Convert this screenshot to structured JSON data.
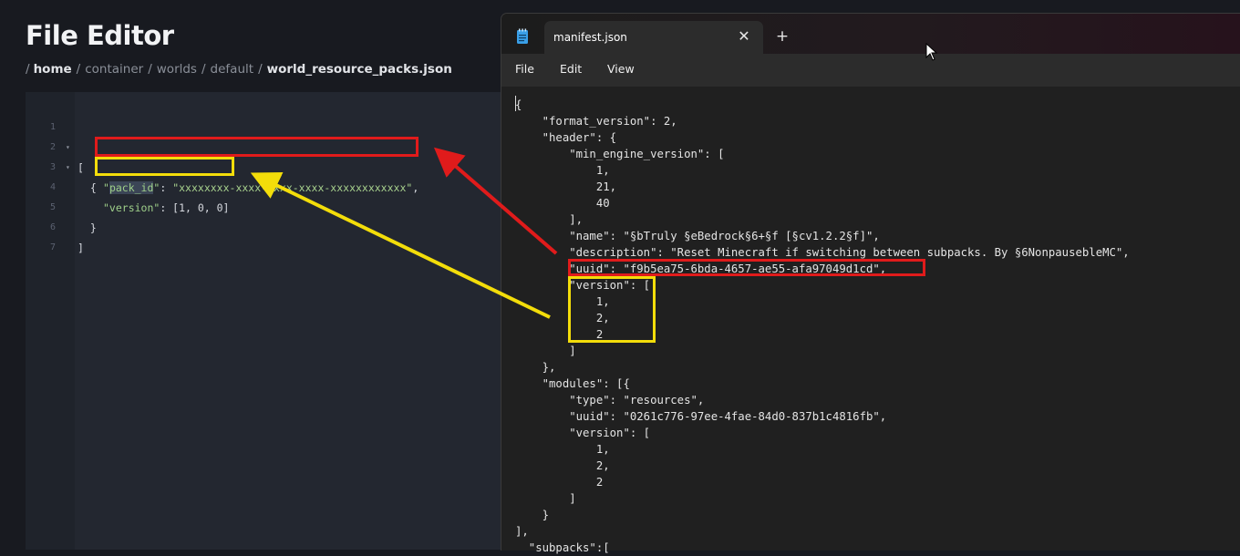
{
  "page": {
    "title": "File Editor",
    "breadcrumb": {
      "separator": "/",
      "items": [
        "home",
        "container",
        "worlds",
        "default",
        "world_resource_packs.json"
      ]
    }
  },
  "editor": {
    "lines": [
      {
        "num": "1",
        "fold": "▾",
        "text": "["
      },
      {
        "num": "2",
        "fold": "▾",
        "text": "  {"
      },
      {
        "num": "3",
        "fold": "",
        "key_pre": "\"",
        "key_word": "pack_id",
        "key_post": "\"",
        "colon": ": ",
        "value": "\"xxxxxxxx-xxxx-xxxx-xxxx-xxxxxxxxxxxx\"",
        "trail": ","
      },
      {
        "num": "4",
        "fold": "",
        "key": "\"version\"",
        "colon": ": ",
        "value": "[1, 0, 0]",
        "trail": ""
      },
      {
        "num": "5",
        "fold": "",
        "text": "  }"
      },
      {
        "num": "6",
        "fold": "",
        "text": "]"
      },
      {
        "num": "7",
        "fold": "",
        "text": ""
      }
    ]
  },
  "notepad": {
    "tab_title": "manifest.json",
    "tab_close_icon": "close-icon",
    "new_tab_icon": "plus-icon",
    "menu": [
      "File",
      "Edit",
      "View"
    ],
    "lines": [
      "{",
      "    \"format_version\": 2,",
      "    \"header\": {",
      "        \"min_engine_version\": [",
      "            1,",
      "            21,",
      "            40",
      "        ],",
      "        \"name\": \"§bTruly §eBedrock§6+§f [§cv1.2.2§f]\",",
      "        \"description\": \"Reset Minecraft if switching between subpacks. By §6NonpausebleMC\",",
      "        \"uuid\": \"f9b5ea75-6bda-4657-ae55-afa97049d1cd\",",
      "        \"version\": [",
      "            1,",
      "            2,",
      "            2",
      "        ]",
      "    },",
      "    \"modules\": [{",
      "        \"type\": \"resources\",",
      "        \"uuid\": \"0261c776-97ee-4fae-84d0-837b1c4816fb\",",
      "        \"version\": [",
      "            1,",
      "            2,",
      "            2",
      "        ]",
      "    }",
      "],",
      "  \"subpacks\":["
    ]
  },
  "colors": {
    "annotation_red": "#e01b1b",
    "annotation_yellow": "#f3dd0a"
  }
}
